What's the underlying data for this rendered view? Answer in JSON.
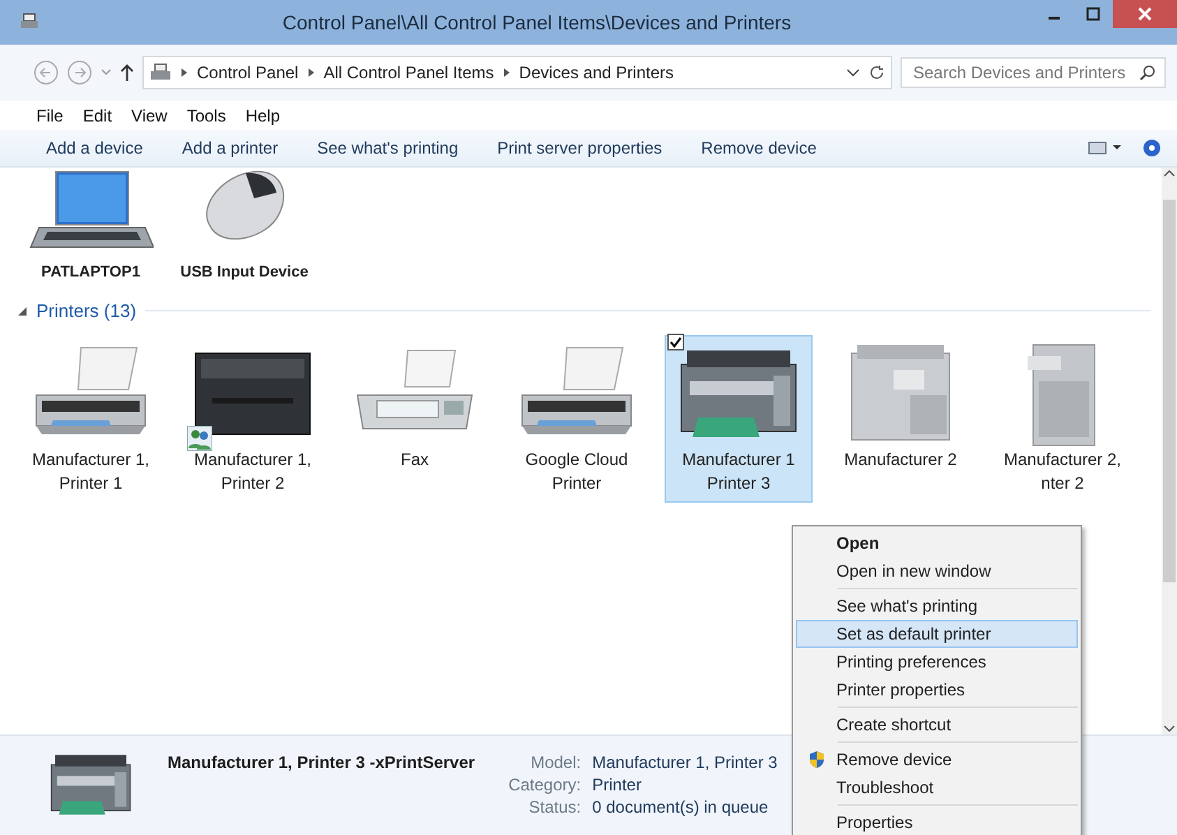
{
  "window": {
    "title": "Control Panel\\All Control Panel Items\\Devices and Printers"
  },
  "address_bar": {
    "crumbs": [
      "Control Panel",
      "All Control Panel Items",
      "Devices and Printers"
    ],
    "search": {
      "placeholder": "Search Devices and Printers"
    }
  },
  "menu_bar": [
    "File",
    "Edit",
    "View",
    "Tools",
    "Help"
  ],
  "command_bar": [
    "Add a device",
    "Add a printer",
    "See what's printing",
    "Print server properties",
    "Remove device"
  ],
  "devices": [
    {
      "kind": "laptop",
      "lines": [
        "PATLAPTOP1"
      ]
    },
    {
      "kind": "mouse",
      "lines": [
        "USB Input Device"
      ]
    }
  ],
  "printers_group": {
    "title": "Printers (13)",
    "expanded": true
  },
  "printers": [
    {
      "kind": "inkjet",
      "lines": [
        "Manufacturer 1,",
        "Printer 1"
      ],
      "selected": false,
      "shared": false
    },
    {
      "kind": "laser",
      "lines": [
        "Manufacturer 1,",
        "Printer 2"
      ],
      "selected": false,
      "shared": true
    },
    {
      "kind": "fax",
      "lines": [
        "Fax"
      ],
      "selected": false,
      "shared": false
    },
    {
      "kind": "inkjet",
      "lines": [
        "Google Cloud",
        "Printer"
      ],
      "selected": false,
      "shared": false
    },
    {
      "kind": "mfp",
      "lines": [
        "Manufacturer 1",
        "Printer 3"
      ],
      "selected": true,
      "shared": false
    },
    {
      "kind": "copier",
      "lines": [
        "Manufacturer 2"
      ],
      "selected": false,
      "shared": false
    },
    {
      "kind": "tower",
      "lines": [
        "Manufacturer 2,",
        "nter 2"
      ],
      "selected": false,
      "shared": false
    }
  ],
  "details": {
    "name": "Manufacturer 1, Printer 3 -xPrintServer",
    "fields": [
      {
        "label": "Model:",
        "value": "Manufacturer 1, Printer 3"
      },
      {
        "label": "Category:",
        "value": "Printer"
      },
      {
        "label": "Status:",
        "value": "0 document(s) in queue"
      }
    ]
  },
  "context_menu": [
    {
      "kind": "item",
      "label": "Open",
      "default": true,
      "selected": false,
      "shield": false
    },
    {
      "kind": "item",
      "label": "Open in new window",
      "default": false,
      "selected": false,
      "shield": false
    },
    {
      "kind": "separator"
    },
    {
      "kind": "item",
      "label": "See what's printing",
      "default": false,
      "selected": false,
      "shield": false
    },
    {
      "kind": "item",
      "label": "Set as default printer",
      "default": false,
      "selected": true,
      "shield": false
    },
    {
      "kind": "item",
      "label": "Printing preferences",
      "default": false,
      "selected": false,
      "shield": false
    },
    {
      "kind": "item",
      "label": "Printer properties",
      "default": false,
      "selected": false,
      "shield": false
    },
    {
      "kind": "separator"
    },
    {
      "kind": "item",
      "label": "Create shortcut",
      "default": false,
      "selected": false,
      "shield": false
    },
    {
      "kind": "separator"
    },
    {
      "kind": "item",
      "label": "Remove device",
      "default": false,
      "selected": false,
      "shield": true
    },
    {
      "kind": "item",
      "label": "Troubleshoot",
      "default": false,
      "selected": false,
      "shield": false
    },
    {
      "kind": "separator"
    },
    {
      "kind": "item",
      "label": "Properties",
      "default": false,
      "selected": false,
      "shield": false
    }
  ]
}
